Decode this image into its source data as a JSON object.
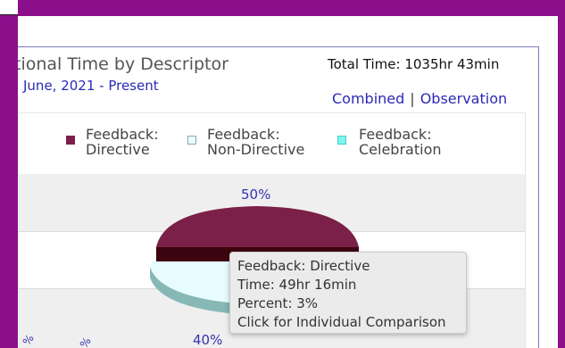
{
  "panel": {
    "title": "tional Time by Descriptor",
    "date_range": "June, 2021 - Present",
    "total_time": "Total Time: 1035hr 43min",
    "links": {
      "combined": "Combined",
      "separator": "|",
      "observation": "Observation"
    }
  },
  "legend": [
    {
      "line1": "Feedback:",
      "line2": "Directive",
      "color": "#7b2048"
    },
    {
      "line1": "Feedback:",
      "line2": "Non-Directive",
      "color": "#e8fbff"
    },
    {
      "line1": "Feedback:",
      "line2": "Celebration",
      "color": "#7ef5f0"
    }
  ],
  "chart_data": {
    "type": "pie",
    "labels": [
      "50%",
      "40%"
    ],
    "axis_fragments": [
      "%",
      "%"
    ]
  },
  "tooltip": {
    "name": "Feedback: Directive",
    "time": "Time: 49hr 16min",
    "percent": "Percent: 3%",
    "action": "Click for Individual Comparison"
  }
}
